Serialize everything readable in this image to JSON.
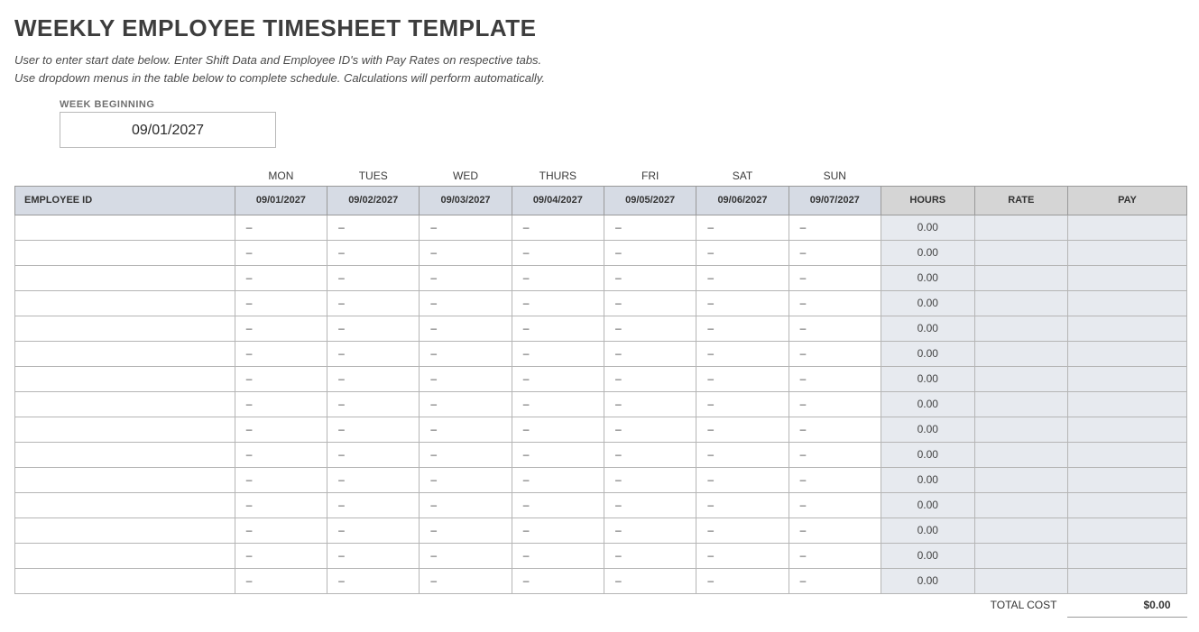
{
  "title": "WEEKLY EMPLOYEE TIMESHEET TEMPLATE",
  "instructions": {
    "line1": "User to enter start date below.  Enter Shift Data and Employee ID's with Pay Rates on respective tabs.",
    "line2": "Use dropdown menus in the table below to complete schedule. Calculations will perform automatically."
  },
  "week": {
    "label": "WEEK BEGINNING",
    "value": "09/01/2027"
  },
  "days": [
    "MON",
    "TUES",
    "WED",
    "THURS",
    "FRI",
    "SAT",
    "SUN"
  ],
  "dates": [
    "09/01/2027",
    "09/02/2027",
    "09/03/2027",
    "09/04/2027",
    "09/05/2027",
    "09/06/2027",
    "09/07/2027"
  ],
  "headers": {
    "employee": "EMPLOYEE ID",
    "hours": "HOURS",
    "rate": "RATE",
    "pay": "PAY"
  },
  "rows": [
    {
      "employee": "",
      "shifts": [
        "–",
        "–",
        "–",
        "–",
        "–",
        "–",
        "–"
      ],
      "hours": "0.00",
      "rate": "",
      "pay": ""
    },
    {
      "employee": "",
      "shifts": [
        "–",
        "–",
        "–",
        "–",
        "–",
        "–",
        "–"
      ],
      "hours": "0.00",
      "rate": "",
      "pay": ""
    },
    {
      "employee": "",
      "shifts": [
        "–",
        "–",
        "–",
        "–",
        "–",
        "–",
        "–"
      ],
      "hours": "0.00",
      "rate": "",
      "pay": ""
    },
    {
      "employee": "",
      "shifts": [
        "–",
        "–",
        "–",
        "–",
        "–",
        "–",
        "–"
      ],
      "hours": "0.00",
      "rate": "",
      "pay": ""
    },
    {
      "employee": "",
      "shifts": [
        "–",
        "–",
        "–",
        "–",
        "–",
        "–",
        "–"
      ],
      "hours": "0.00",
      "rate": "",
      "pay": ""
    },
    {
      "employee": "",
      "shifts": [
        "–",
        "–",
        "–",
        "–",
        "–",
        "–",
        "–"
      ],
      "hours": "0.00",
      "rate": "",
      "pay": ""
    },
    {
      "employee": "",
      "shifts": [
        "–",
        "–",
        "–",
        "–",
        "–",
        "–",
        "–"
      ],
      "hours": "0.00",
      "rate": "",
      "pay": ""
    },
    {
      "employee": "",
      "shifts": [
        "–",
        "–",
        "–",
        "–",
        "–",
        "–",
        "–"
      ],
      "hours": "0.00",
      "rate": "",
      "pay": ""
    },
    {
      "employee": "",
      "shifts": [
        "–",
        "–",
        "–",
        "–",
        "–",
        "–",
        "–"
      ],
      "hours": "0.00",
      "rate": "",
      "pay": ""
    },
    {
      "employee": "",
      "shifts": [
        "–",
        "–",
        "–",
        "–",
        "–",
        "–",
        "–"
      ],
      "hours": "0.00",
      "rate": "",
      "pay": ""
    },
    {
      "employee": "",
      "shifts": [
        "–",
        "–",
        "–",
        "–",
        "–",
        "–",
        "–"
      ],
      "hours": "0.00",
      "rate": "",
      "pay": ""
    },
    {
      "employee": "",
      "shifts": [
        "–",
        "–",
        "–",
        "–",
        "–",
        "–",
        "–"
      ],
      "hours": "0.00",
      "rate": "",
      "pay": ""
    },
    {
      "employee": "",
      "shifts": [
        "–",
        "–",
        "–",
        "–",
        "–",
        "–",
        "–"
      ],
      "hours": "0.00",
      "rate": "",
      "pay": ""
    },
    {
      "employee": "",
      "shifts": [
        "–",
        "–",
        "–",
        "–",
        "–",
        "–",
        "–"
      ],
      "hours": "0.00",
      "rate": "",
      "pay": ""
    },
    {
      "employee": "",
      "shifts": [
        "–",
        "–",
        "–",
        "–",
        "–",
        "–",
        "–"
      ],
      "hours": "0.00",
      "rate": "",
      "pay": ""
    }
  ],
  "footer": {
    "total_label": "TOTAL COST",
    "total_value": "$0.00"
  }
}
